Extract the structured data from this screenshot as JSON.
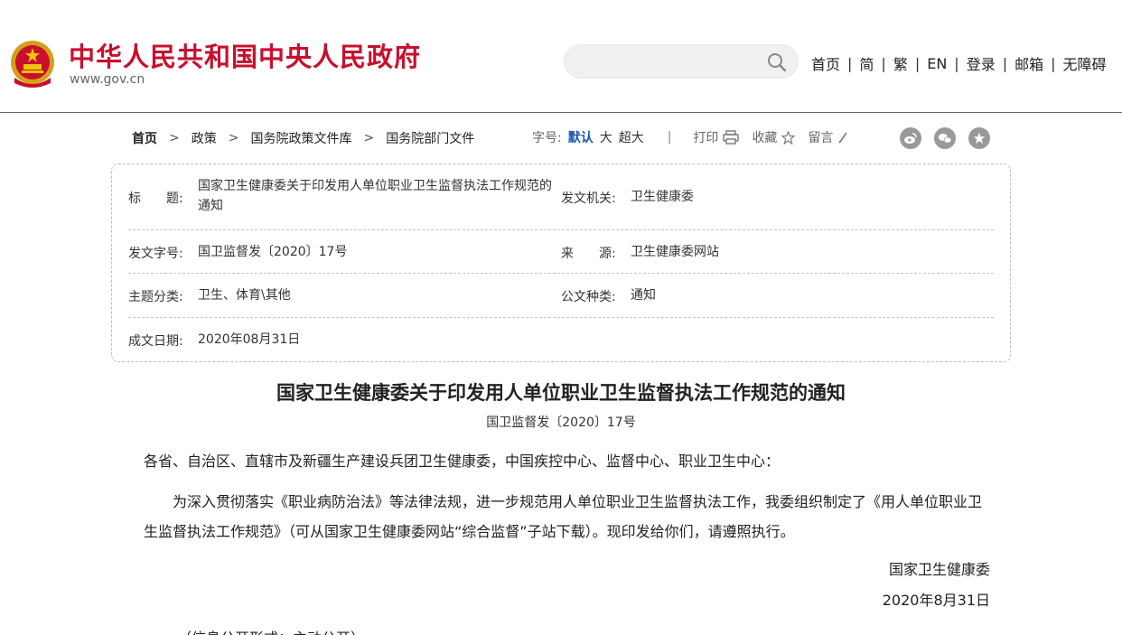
{
  "header": {
    "site_title": "中华人民共和国中央人民政府",
    "site_url": "www.gov.cn",
    "search_placeholder": "",
    "nav": [
      "首页",
      "简",
      "繁",
      "EN",
      "登录",
      "邮箱",
      "无障碍"
    ],
    "brand_color": "#c8102e"
  },
  "breadcrumb": [
    "首页",
    "政策",
    "国务院政策文件库",
    "国务院部门文件"
  ],
  "tools": {
    "font_size_label": "字号:",
    "font_sizes": [
      "默认",
      "大",
      "超大"
    ],
    "print_label": "打印",
    "favorite_label": "收藏",
    "comment_label": "留言"
  },
  "info": {
    "title_label": "标　　题:",
    "title_value": "国家卫生健康委关于印发用人单位职业卫生监督执法工作规范的通知",
    "issuer_label": "发文机关:",
    "issuer_value": "卫生健康委",
    "docno_label": "发文字号:",
    "docno_value": "国卫监督发〔2020〕17号",
    "source_label": "来　　源:",
    "source_value": "卫生健康委网站",
    "topic_label": "主题分类:",
    "topic_value": "卫生、体育\\其他",
    "type_label": "公文种类:",
    "type_value": "通知",
    "date_label": "成文日期:",
    "date_value": "2020年08月31日"
  },
  "article": {
    "title": "国家卫生健康委关于印发用人单位职业卫生监督执法工作规范的通知",
    "doc_number": "国卫监督发〔2020〕17号",
    "salutation": "各省、自治区、直辖市及新疆生产建设兵团卫生健康委，中国疾控中心、监督中心、职业卫生中心：",
    "body": "为深入贯彻落实《职业病防治法》等法律法规，进一步规范用人单位职业卫生监督执法工作，我委组织制定了《用人单位职业卫生监督执法工作规范》（可从国家卫生健康委网站“综合监督”子站下载）。现印发给你们，请遵照执行。",
    "signer": "国家卫生健康委",
    "sign_date": "2020年8月31日",
    "footnote": "（信息公开形式：主动公开）"
  }
}
